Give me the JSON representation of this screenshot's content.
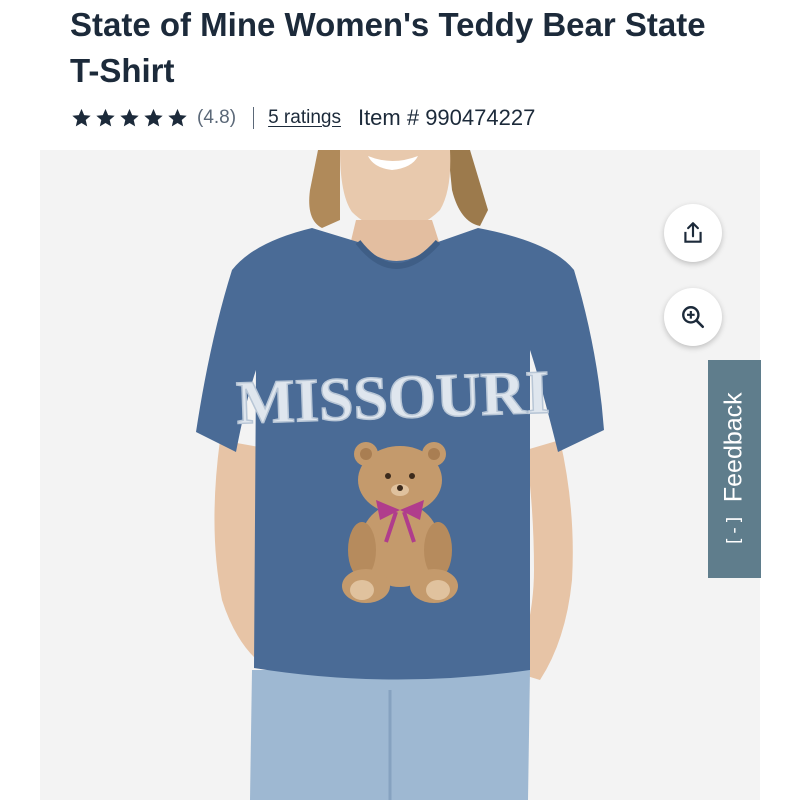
{
  "product": {
    "title": "State of Mine Women's Teddy Bear State T-Shirt",
    "rating_value": "(4.8)",
    "stars_filled": 5,
    "ratings_link": "5 ratings",
    "item_number": "Item # 990474227"
  },
  "image": {
    "shirt_text": "MISSOURI",
    "shirt_color": "#4a6b96",
    "graphic_letter_color": "#dfe6ee",
    "bow_color": "#b03d8c",
    "bear_color": "#c49a6c"
  },
  "actions": {
    "share_icon": "share-icon",
    "zoom_icon": "zoom-in-icon"
  },
  "feedback": {
    "label": "Feedback",
    "icon": "[-]"
  },
  "colors": {
    "title": "#1c2a3a",
    "feedback_bg": "#5f7d8c"
  }
}
